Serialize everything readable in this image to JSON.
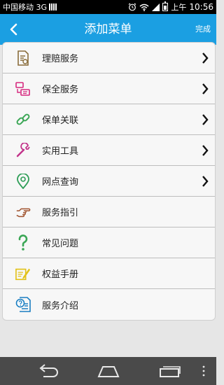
{
  "status_bar": {
    "carrier": "中国移动 3G",
    "time_prefix": "上午",
    "time": "10:56"
  },
  "header": {
    "title": "添加菜单",
    "done_label": "完成",
    "back_icon": "chevron-left-icon",
    "bg_color": "#1b9fe2"
  },
  "menu": {
    "items": [
      {
        "label": "理赔服务",
        "icon": "claim-document-icon",
        "has_arrow": true
      },
      {
        "label": "保全服务",
        "icon": "service-blocks-icon",
        "has_arrow": true
      },
      {
        "label": "保单关联",
        "icon": "link-icon",
        "has_arrow": true
      },
      {
        "label": "实用工具",
        "icon": "wrench-icon",
        "has_arrow": true
      },
      {
        "label": "网点查询",
        "icon": "location-pin-icon",
        "has_arrow": true
      },
      {
        "label": "服务指引",
        "icon": "pointing-hand-icon",
        "has_arrow": false
      },
      {
        "label": "常见问题",
        "icon": "question-mark-icon",
        "has_arrow": false
      },
      {
        "label": "权益手册",
        "icon": "pencil-note-icon",
        "has_arrow": false
      },
      {
        "label": "服务介绍",
        "icon": "help-document-icon",
        "has_arrow": false
      }
    ]
  },
  "nav_bar": {
    "buttons": [
      "back-nav-icon",
      "home-nav-icon",
      "recent-apps-icon",
      "menu-dots-icon"
    ]
  }
}
